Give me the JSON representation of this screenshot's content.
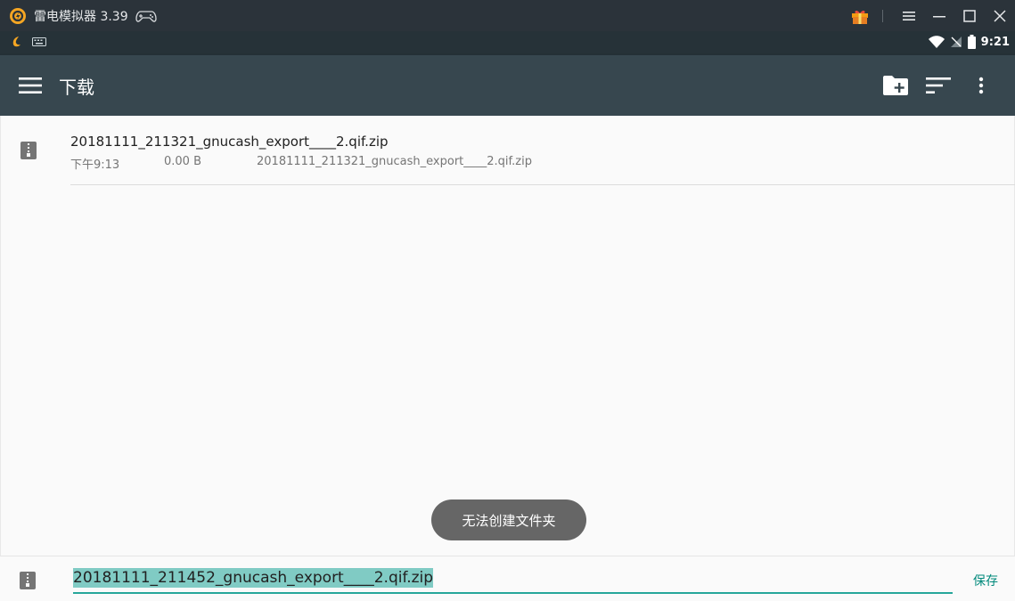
{
  "window": {
    "title": "雷电模拟器 3.39",
    "icons": [
      "app-logo-icon",
      "gamepad-icon",
      "gift-icon",
      "menu-icon",
      "minimize-icon",
      "maximize-icon",
      "close-icon"
    ]
  },
  "status_bar": {
    "time": "9:21",
    "icons": [
      "notification-icon",
      "keyboard-icon",
      "wifi-icon",
      "no-signal-icon",
      "battery-icon"
    ]
  },
  "toolbar": {
    "title": "下载",
    "icons": [
      "hamburger-menu-icon",
      "new-folder-icon",
      "sort-icon",
      "more-options-icon"
    ]
  },
  "files": [
    {
      "name": "20181111_211321_gnucash_export____2.qif.zip",
      "time": "下午9:13",
      "size": "0.00 B",
      "summary": "20181111_211321_gnucash_export____2.qif.zip",
      "icon": "zip-file-icon"
    }
  ],
  "toast": {
    "message": "无法创建文件夹"
  },
  "save_bar": {
    "filename": "20181111_211452_gnucash_export____2.qif.zip",
    "save_label": "保存",
    "icon": "zip-file-icon"
  },
  "colors": {
    "titlebar": "#2b333a",
    "statusbar": "#263238",
    "toolbar": "#37474f",
    "accent": "#26a69a",
    "selection": "#80cbc4",
    "save_button": "#00897b",
    "toast": "#666666"
  }
}
